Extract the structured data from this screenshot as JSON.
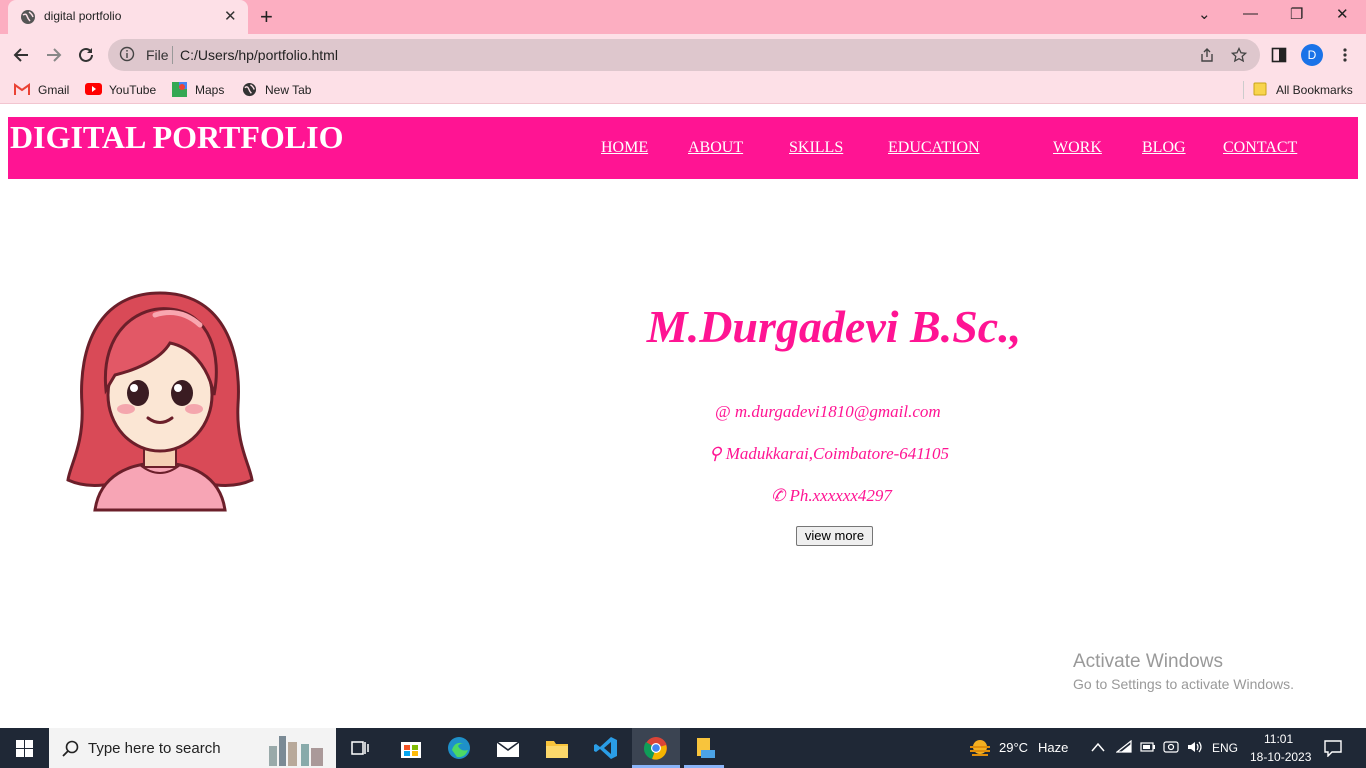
{
  "browser": {
    "tab_title": "digital portfolio",
    "close_tab": "✕",
    "new_tab": "+",
    "url_scheme_label": "File",
    "url": "C:/Users/hp/portfolio.html",
    "profile_initial": "D",
    "window_controls": {
      "collapse": "⌄",
      "minimize": "—",
      "restore": "❐",
      "close": "✕"
    }
  },
  "bookmarks": {
    "items": [
      {
        "label": "Gmail",
        "icon": "gmail-icon"
      },
      {
        "label": "YouTube",
        "icon": "youtube-icon"
      },
      {
        "label": "Maps",
        "icon": "maps-icon"
      },
      {
        "label": "New Tab",
        "icon": "globe-icon"
      }
    ],
    "all_bookmarks": "All Bookmarks"
  },
  "site": {
    "brand": "DIGITAL PORTFOLIO",
    "nav": [
      "HOME",
      "ABOUT",
      "SKILLS",
      "EDUCATION",
      "WORK",
      "BLOG",
      "CONTACT"
    ],
    "name": "M.Durgadevi B.Sc.,",
    "email_icon": "@",
    "email": "m.durgadevi1810@gmail.com",
    "location_icon": "⚲",
    "location": "Madukkarai,Coimbatore-641105",
    "phone_icon": "✆",
    "phone": "Ph.xxxxxx4297",
    "view_more": "view more",
    "colors": {
      "accent": "#ff1493"
    }
  },
  "watermark": {
    "line1": "Activate Windows",
    "line2": "Go to Settings to activate Windows."
  },
  "taskbar": {
    "search_placeholder": "Type here to search",
    "weather_temp": "29°C",
    "weather_desc": "Haze",
    "language": "ENG",
    "time": "11:01",
    "date": "18-10-2023"
  }
}
